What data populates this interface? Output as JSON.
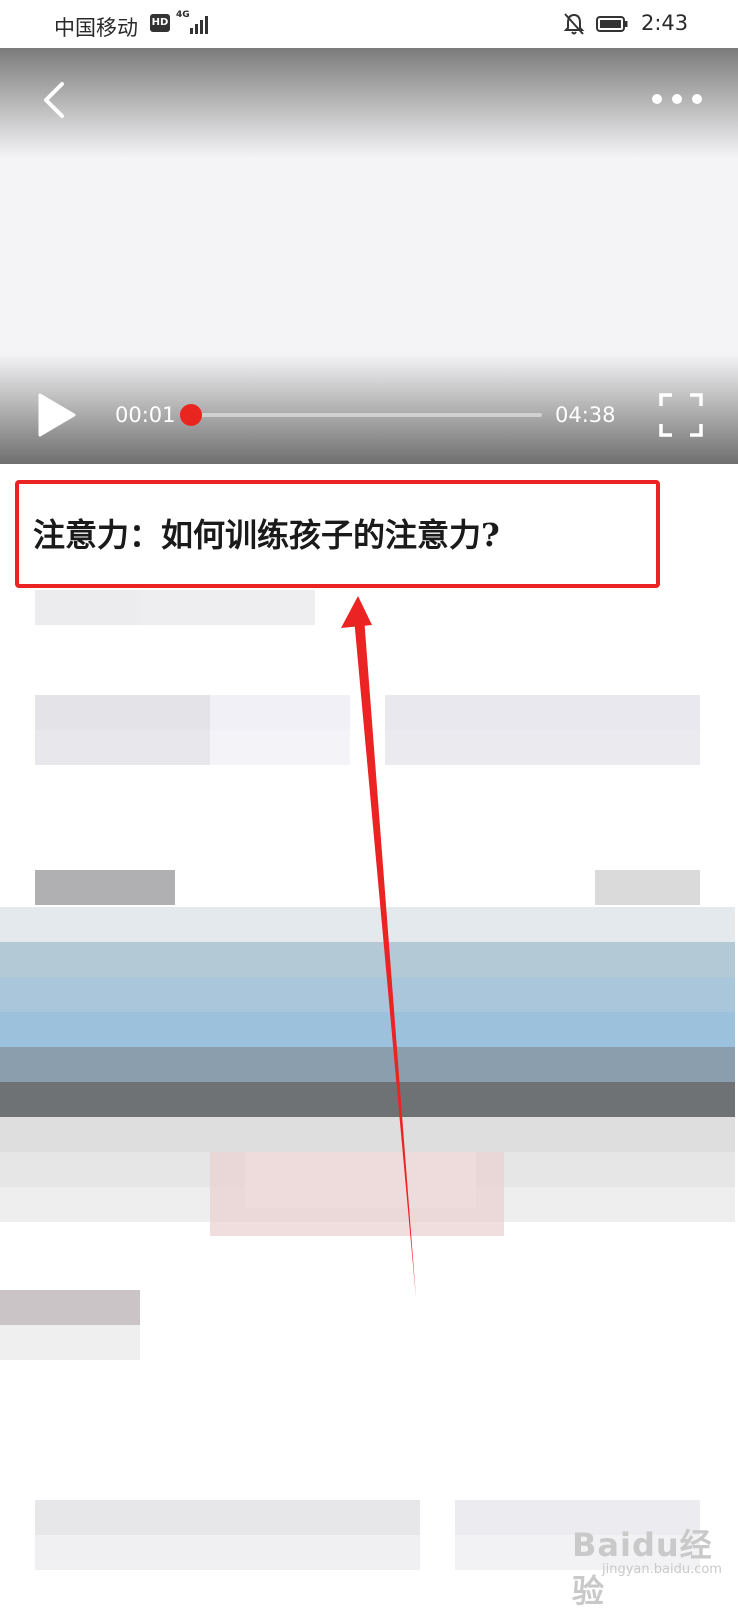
{
  "status_bar": {
    "carrier": "中国移动",
    "hd": "HD",
    "network": "4G",
    "time": "2:43"
  },
  "video": {
    "current_time": "00:01",
    "total_time": "04:38",
    "progress": 0.004
  },
  "article": {
    "title": "注意力：如何训练孩子的注意力?"
  },
  "watermark": {
    "brand": "Baidu经验",
    "url": "jingyan.baidu.com"
  },
  "colors": {
    "accent_red": "#e8251f",
    "highlight_red": "#ec2323"
  },
  "icons": [
    "back-icon",
    "more-icon",
    "play-icon",
    "fullscreen-icon",
    "bell-off-icon",
    "battery-icon",
    "signal-icon"
  ]
}
